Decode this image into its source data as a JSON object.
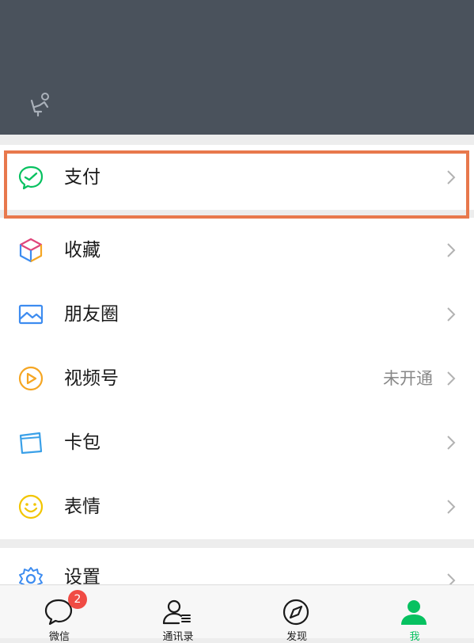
{
  "menu": {
    "pay": {
      "label": "支付",
      "icon": "wallet-pay-icon"
    },
    "favorites": {
      "label": "收藏",
      "icon": "cube-favorites-icon"
    },
    "moments": {
      "label": "朋友圈",
      "icon": "image-moments-icon"
    },
    "channels": {
      "label": "视频号",
      "value": "未开通",
      "icon": "play-channels-icon"
    },
    "cards": {
      "label": "卡包",
      "icon": "card-wallet-icon"
    },
    "stickers": {
      "label": "表情",
      "icon": "smiley-icon"
    },
    "settings": {
      "label": "设置",
      "icon": "gear-icon"
    }
  },
  "tabbar": {
    "tabs": [
      {
        "label": "微信",
        "badge": "2",
        "icon": "chat-bubble-icon"
      },
      {
        "label": "通讯录",
        "icon": "contacts-icon"
      },
      {
        "label": "发现",
        "icon": "compass-icon"
      },
      {
        "label": "我",
        "icon": "person-icon",
        "active": true
      }
    ]
  },
  "colors": {
    "header_bg": "#4a525c",
    "accent": "#07c160",
    "highlight": "#e8784c",
    "badge": "#f04b44"
  }
}
